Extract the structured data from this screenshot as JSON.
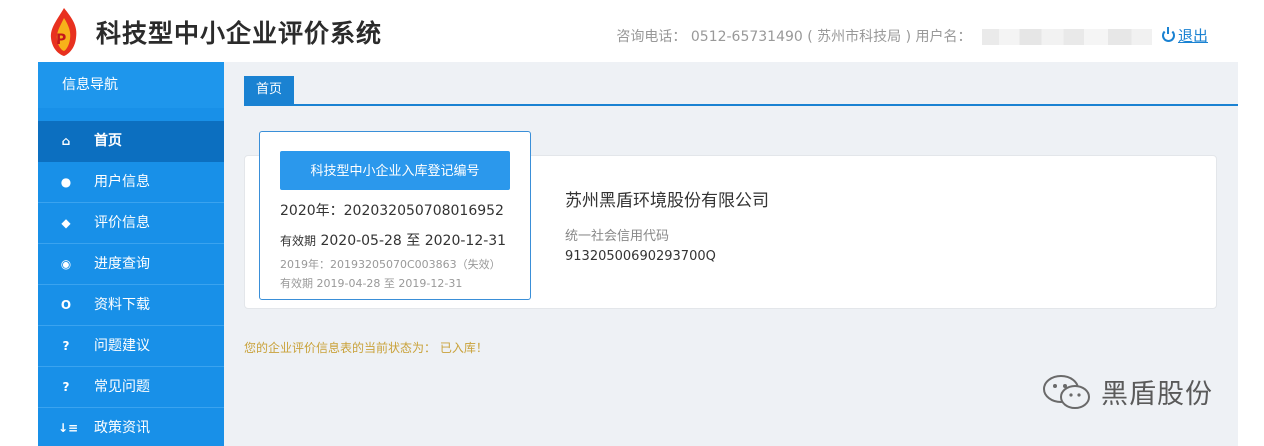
{
  "header": {
    "title": "科技型中小企业评价系统",
    "hotline_label": "咨询电话：",
    "hotline_value": "0512-65731490 ( 苏州市科技局 )",
    "user_label": "用户名：",
    "logout_label": "退出",
    "logo_icon": "flame-logo-icon",
    "accent": "#1a82d2"
  },
  "sidebar": {
    "heading": "信息导航",
    "items": [
      {
        "label": "首页",
        "icon": "home-icon",
        "glyph": "⌂",
        "active": true
      },
      {
        "label": "用户信息",
        "icon": "user-icon",
        "glyph": "●"
      },
      {
        "label": "评价信息",
        "icon": "tag-icon",
        "glyph": "◆"
      },
      {
        "label": "进度查询",
        "icon": "eye-icon",
        "glyph": "◉"
      },
      {
        "label": "资料下载",
        "icon": "download-icon",
        "glyph": "O"
      },
      {
        "label": "问题建议",
        "icon": "question-icon",
        "glyph": "?"
      },
      {
        "label": "常见问题",
        "icon": "faq-icon",
        "glyph": "?"
      },
      {
        "label": "政策资讯",
        "icon": "sort-icon",
        "glyph": "↓≡"
      }
    ],
    "bg": "#1890e8",
    "active_bg": "#0c6fc0"
  },
  "main": {
    "tab_label": "首页",
    "registration": {
      "button_label": "科技型中小企业入库登记编号",
      "line1": "2020年：202032050708016952",
      "validity_label": "有效期",
      "validity_value": " 2020-05-28 至 2020-12-31",
      "line3": "2019年：20193205070C003863（失效）",
      "line4": "有效期 2019-04-28 至 2019-12-31"
    },
    "company_name": "苏州黑盾环境股份有限公司",
    "credit_code_label": "统一社会信用代码",
    "credit_code_value": "91320500690293700Q",
    "status_text": "您的企业评价信息表的当前状态为：  已入库！"
  },
  "watermark": {
    "text": "黑盾股份",
    "icon": "wechat-icon"
  }
}
